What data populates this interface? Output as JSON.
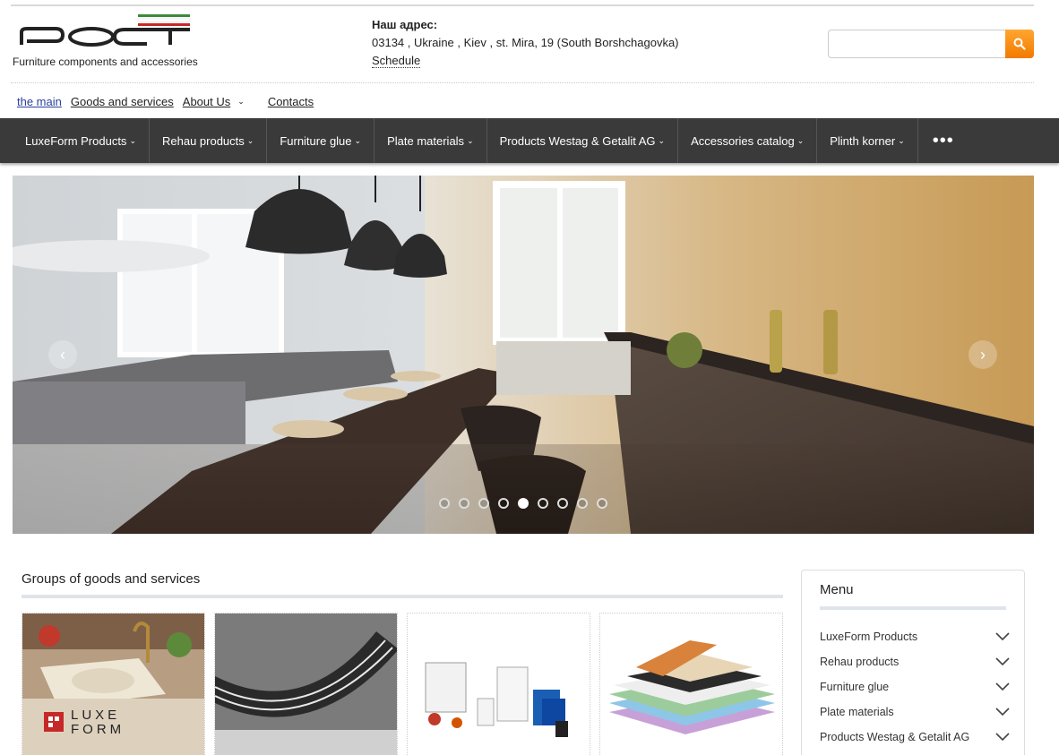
{
  "header": {
    "logo_text": "РОСТ",
    "tagline": "Furniture components and accessories",
    "address_label": "Наш адрес:",
    "address": "03134 , Ukraine , Kiev , st. Mira, 19 (South Borshchagovka)",
    "schedule_link": "Schedule",
    "search": {
      "placeholder": "",
      "value": "",
      "icon": "search-icon"
    }
  },
  "top_links": [
    {
      "label": "the main"
    },
    {
      "label": "Goods and services"
    },
    {
      "label": "About Us"
    },
    {
      "label": "Contacts"
    }
  ],
  "nav": {
    "items": [
      {
        "label": "LuxeForm Products"
      },
      {
        "label": "Rehau products"
      },
      {
        "label": "Furniture glue"
      },
      {
        "label": "Plate materials"
      },
      {
        "label": "Products Westag & Getalit AG"
      },
      {
        "label": "Accessories catalog"
      },
      {
        "label": "Plinth korner"
      }
    ],
    "more": "•••"
  },
  "slider": {
    "slide_count": 9,
    "active_slide": 5,
    "prev": "‹",
    "next": "›"
  },
  "groups": {
    "title": "Groups of goods and services",
    "cards": [
      {
        "name": "luxeform",
        "logo_text_1": "LUXE",
        "logo_text_2": "FORM"
      },
      {
        "name": "rehau-edge"
      },
      {
        "name": "furniture-glue"
      },
      {
        "name": "plate-materials"
      }
    ]
  },
  "sidebar": {
    "title": "Menu",
    "items": [
      {
        "label": "LuxeForm Products"
      },
      {
        "label": "Rehau products"
      },
      {
        "label": "Furniture glue"
      },
      {
        "label": "Plate materials"
      },
      {
        "label": "Products Westag & Getalit AG"
      }
    ]
  },
  "colors": {
    "nav_bg": "#3a3a3a",
    "accent_orange": "#f78d10",
    "link_blue": "#2a3f9c",
    "logo_green": "#3b8a3d",
    "logo_red": "#c62828"
  }
}
